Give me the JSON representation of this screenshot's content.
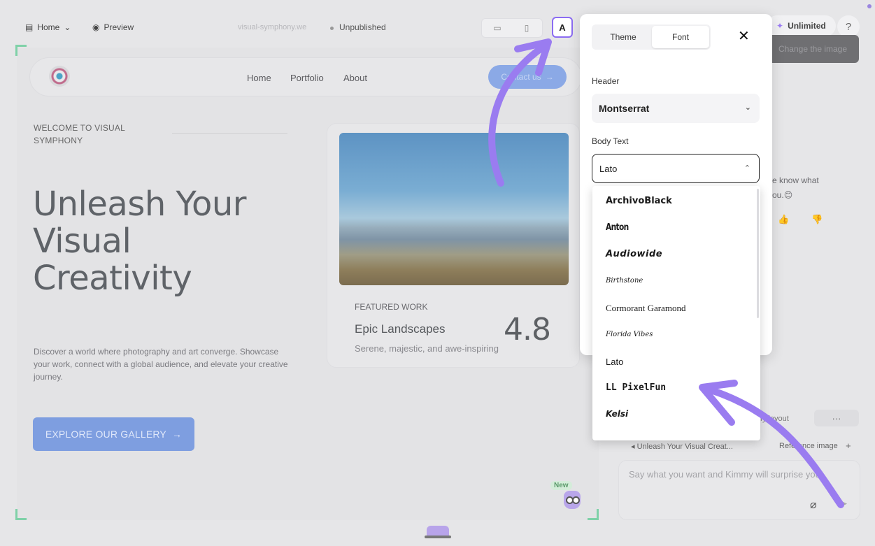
{
  "toolbar": {
    "home_label": "Home",
    "preview_label": "Preview",
    "site_url": "visual-symphony.we",
    "status_label": "Unpublished",
    "font_button": "A",
    "plan_label": "Unlimited",
    "help_label": "?"
  },
  "site": {
    "nav": [
      "Home",
      "Portfolio",
      "About"
    ],
    "contact_label": "Contact us",
    "welcome": "WELCOME TO VISUAL SYMPHONY",
    "hero_line1": "Unleash Your",
    "hero_line2": "Visual",
    "hero_line3": "Creativity",
    "description": "Discover a world where photography and art converge. Showcase your work, connect with a global audience, and elevate your creative journey.",
    "cta_label": "EXPLORE OUR GALLERY",
    "card": {
      "eyebrow": "FEATURED WORK",
      "title": "Epic Landscapes",
      "subtitle": "Serene, majestic, and awe-inspiring",
      "rating": "4.8"
    },
    "new_badge": "New"
  },
  "chat": {
    "change_image": "Change the image",
    "message_line1": "e know what",
    "message_line2": "ou.",
    "layout_chip": "lify layout",
    "more_label": "···",
    "ref_left": "Unleash Your Visual Creat...",
    "ref_right": "Reference image",
    "ref_add": "+",
    "input_placeholder": "Say what you want and Kimmy will surprise you"
  },
  "font_panel": {
    "tabs": [
      "Theme",
      "Font"
    ],
    "active_tab": "Font",
    "close_label": "✕",
    "header_label": "Header",
    "header_font": "Montserrat",
    "body_label": "Body Text",
    "body_font": "Lato",
    "options": [
      "ArchivoBlack",
      "Anton",
      "Audiowide",
      "Birthstone",
      "Cormorant Garamond",
      "Florida Vibes",
      "Lato",
      "LL PixelFun",
      "Kelsi"
    ]
  },
  "colors": {
    "accent": "#8b6cf2",
    "arrow": "#9a7cf0",
    "cta": "#7e9ee0"
  }
}
